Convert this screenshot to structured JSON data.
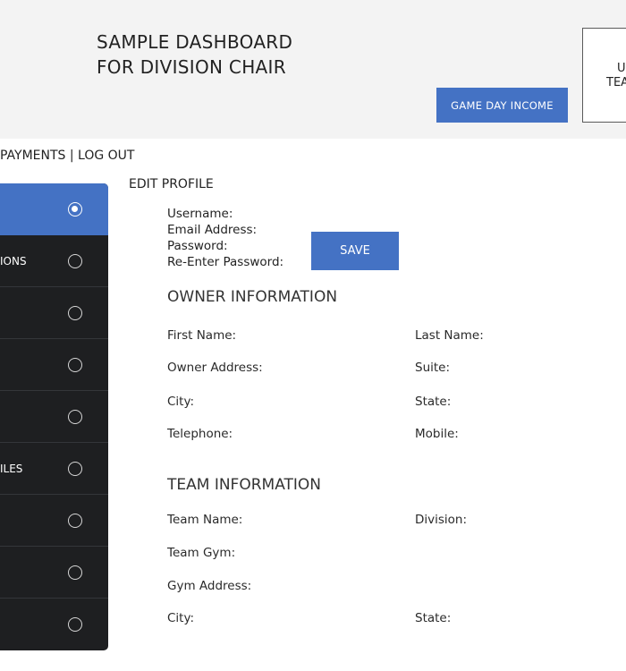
{
  "header": {
    "title_line1": "SAMPLE DASHBOARD",
    "title_line2": "FOR DIVISION CHAIR",
    "game_day_button": "GAME DAY INCOME",
    "team_box_line1": "U",
    "team_box_line2": "TEA"
  },
  "topnav": {
    "text": "PAYMENTS | LOG OUT"
  },
  "sidebar": {
    "items": [
      {
        "label": "",
        "active": true
      },
      {
        "label": "IONS",
        "active": false
      },
      {
        "label": "",
        "active": false
      },
      {
        "label": "",
        "active": false
      },
      {
        "label": "",
        "active": false
      },
      {
        "label": "ILES",
        "active": false
      },
      {
        "label": "",
        "active": false
      },
      {
        "label": "",
        "active": false
      },
      {
        "label": "",
        "active": false
      }
    ]
  },
  "profile": {
    "heading": "EDIT PROFILE",
    "username_label": "Username:",
    "email_label": "Email Address:",
    "password_label": "Password:",
    "reenter_label": "Re-Enter Password:",
    "save_button": "SAVE"
  },
  "owner": {
    "heading": "OWNER INFORMATION",
    "first_name": "First Name:",
    "last_name": "Last Name:",
    "address": "Owner Address:",
    "suite": "Suite:",
    "city": "City:",
    "state": "State:",
    "telephone": "Telephone:",
    "mobile": "Mobile:"
  },
  "team": {
    "heading": "TEAM INFORMATION",
    "team_name": "Team Name:",
    "division": "Division:",
    "team_gym": "Team Gym:",
    "gym_address": "Gym Address:",
    "city": "City:",
    "state": "State:"
  }
}
